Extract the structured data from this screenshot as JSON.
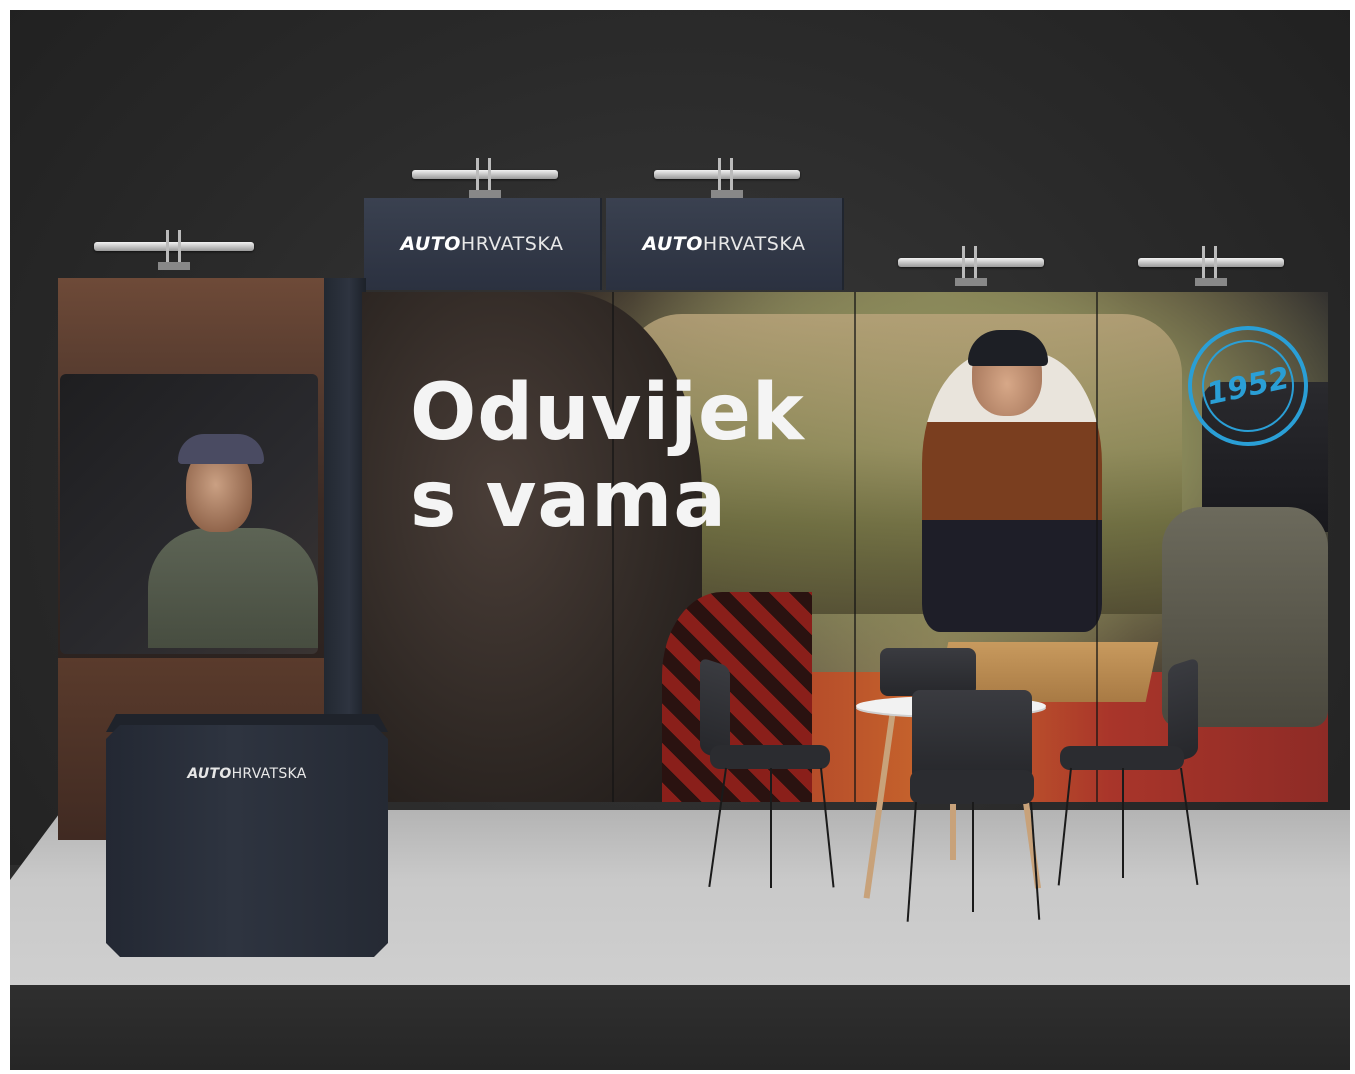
{
  "booth": {
    "header_logos": [
      {
        "auto": "AUTO",
        "rest": "HRVATSKA"
      },
      {
        "auto": "AUTO",
        "rest": "HRVATSKA"
      }
    ],
    "headline": "Oduvijek\ns vama",
    "seal_year": "1952",
    "counter_logo": {
      "auto": "AUTO",
      "rest": "HRVATSKA"
    }
  },
  "colors": {
    "brand_navy": "#2b3140",
    "seal_blue": "#2a9fd6",
    "wall": "#2a2a2a",
    "stage_floor": "#c9c9c9"
  }
}
